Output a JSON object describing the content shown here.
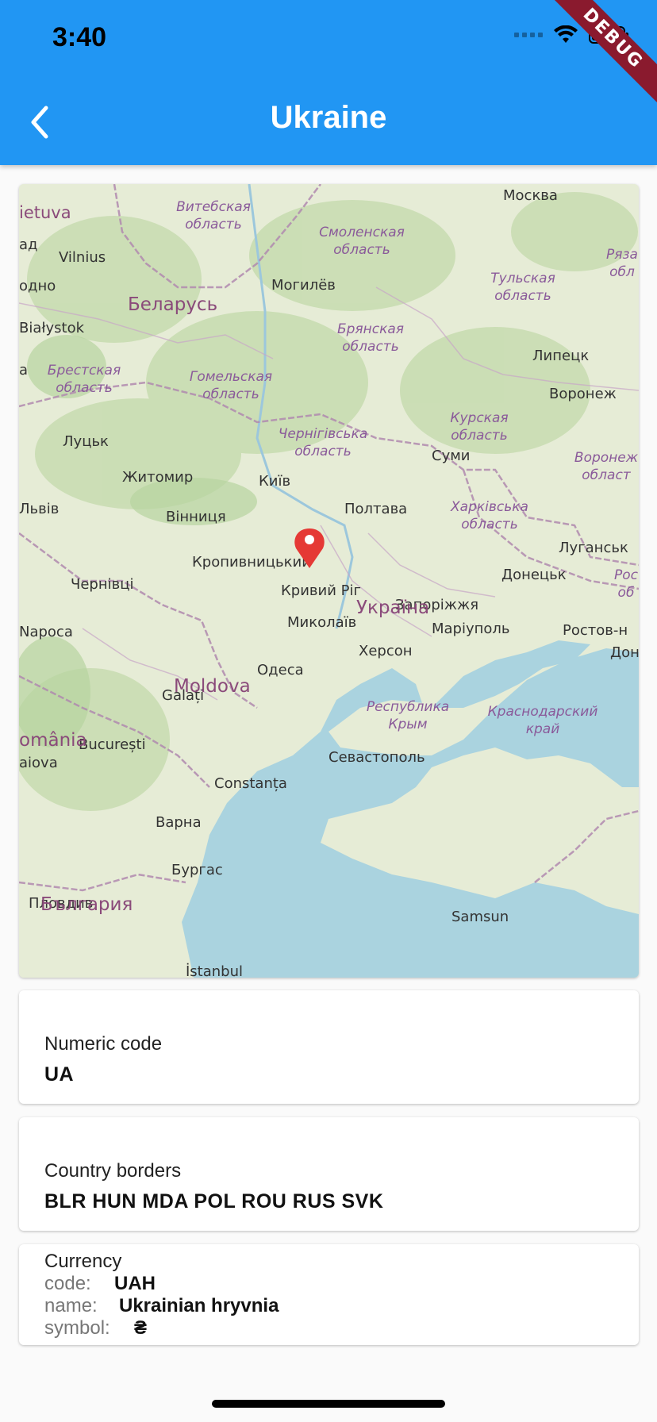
{
  "status_bar": {
    "time": "3:40"
  },
  "debug_banner": "DEBUG",
  "header": {
    "title": "Ukraine"
  },
  "icons": {
    "back": "chevron-left-icon",
    "wifi": "wifi-icon",
    "battery": "battery-icon",
    "signal": "cellular-signal-icon",
    "marker": "map-pin-icon"
  },
  "map": {
    "labels": {
      "moskva": "Москва",
      "lietuva": "ietuva",
      "vilnius": "Vilnius",
      "vitebsk1": "Витебская",
      "vitebsk2": "область",
      "smolensk1": "Смоленская",
      "smolensk2": "область",
      "ryaz1": "Рязa",
      "ryaz2": "обл",
      "ad": "ад",
      "odno": "одно",
      "belarus": "Беларусь",
      "mogilev": "Могилёв",
      "tula1": "Тульская",
      "tula2": "область",
      "bialystok": "Białystok",
      "bryansk1": "Брянская",
      "bryansk2": "область",
      "lipetsk": "Липецк",
      "brest1": "Брестская",
      "brest2": "область",
      "gomel1": "Гомельская",
      "gomel2": "область",
      "a": "a",
      "voronezh": "Воронеж",
      "kursk1": "Курская",
      "kursk2": "область",
      "chernihiv1": "Чернігівська",
      "chernihiv2": "область",
      "voronezh_reg1": "Воронеж",
      "voronezh_reg2": "област",
      "lutsk": "Луцьк",
      "sumy": "Суми",
      "zhytomyr": "Житомир",
      "kyiv": "Київ",
      "lviv": "Львів",
      "vinnytsia": "Вінниця",
      "poltava": "Полтава",
      "kharkiv1": "Харківська",
      "kharkiv2": "область",
      "kropyvnytskyi": "Кропивницький",
      "ukraina": "Україна",
      "luhansk": "Луганськ",
      "chernivtsi": "Чернівці",
      "kryvyi_rih": "Кривий Ріг",
      "donetsk": "Донецьк",
      "ros1": "Рос",
      "ros2": "об",
      "zaporizhzhia": "Запоріжжя",
      "napoca": "Napoca",
      "mykolaiv": "Миколаїв",
      "moldova": "Moldova",
      "mariupol": "Маріуполь",
      "rostov": "Ростов-н",
      "donu": "Дону",
      "kherson": "Херсон",
      "odesa": "Одеса",
      "romania": "omânia",
      "galati": "Galați",
      "krym1": "Республика",
      "krym2": "Крым",
      "krasnodar1": "Краснодарский",
      "krasnodar2": "край",
      "bucuresti": "București",
      "aiova": "aiova",
      "constanta": "Constanța",
      "sevastopol": "Севастополь",
      "varna": "Варна",
      "bulgaria": "България",
      "burgas": "Бургас",
      "plovdiv": "Пловдив",
      "samsun": "Samsun",
      "istanbul": "İstanbul"
    }
  },
  "numeric_code": {
    "label": "Numeric code",
    "value": "UA"
  },
  "borders": {
    "label": "Country borders",
    "value": "BLR HUN MDA POL ROU RUS SVK"
  },
  "currency": {
    "label": "Currency",
    "code_key": "code:",
    "code_val": "UAH",
    "name_key": "name:",
    "name_val": "Ukrainian hryvnia",
    "symbol_key": "symbol:",
    "symbol_val": "₴"
  }
}
